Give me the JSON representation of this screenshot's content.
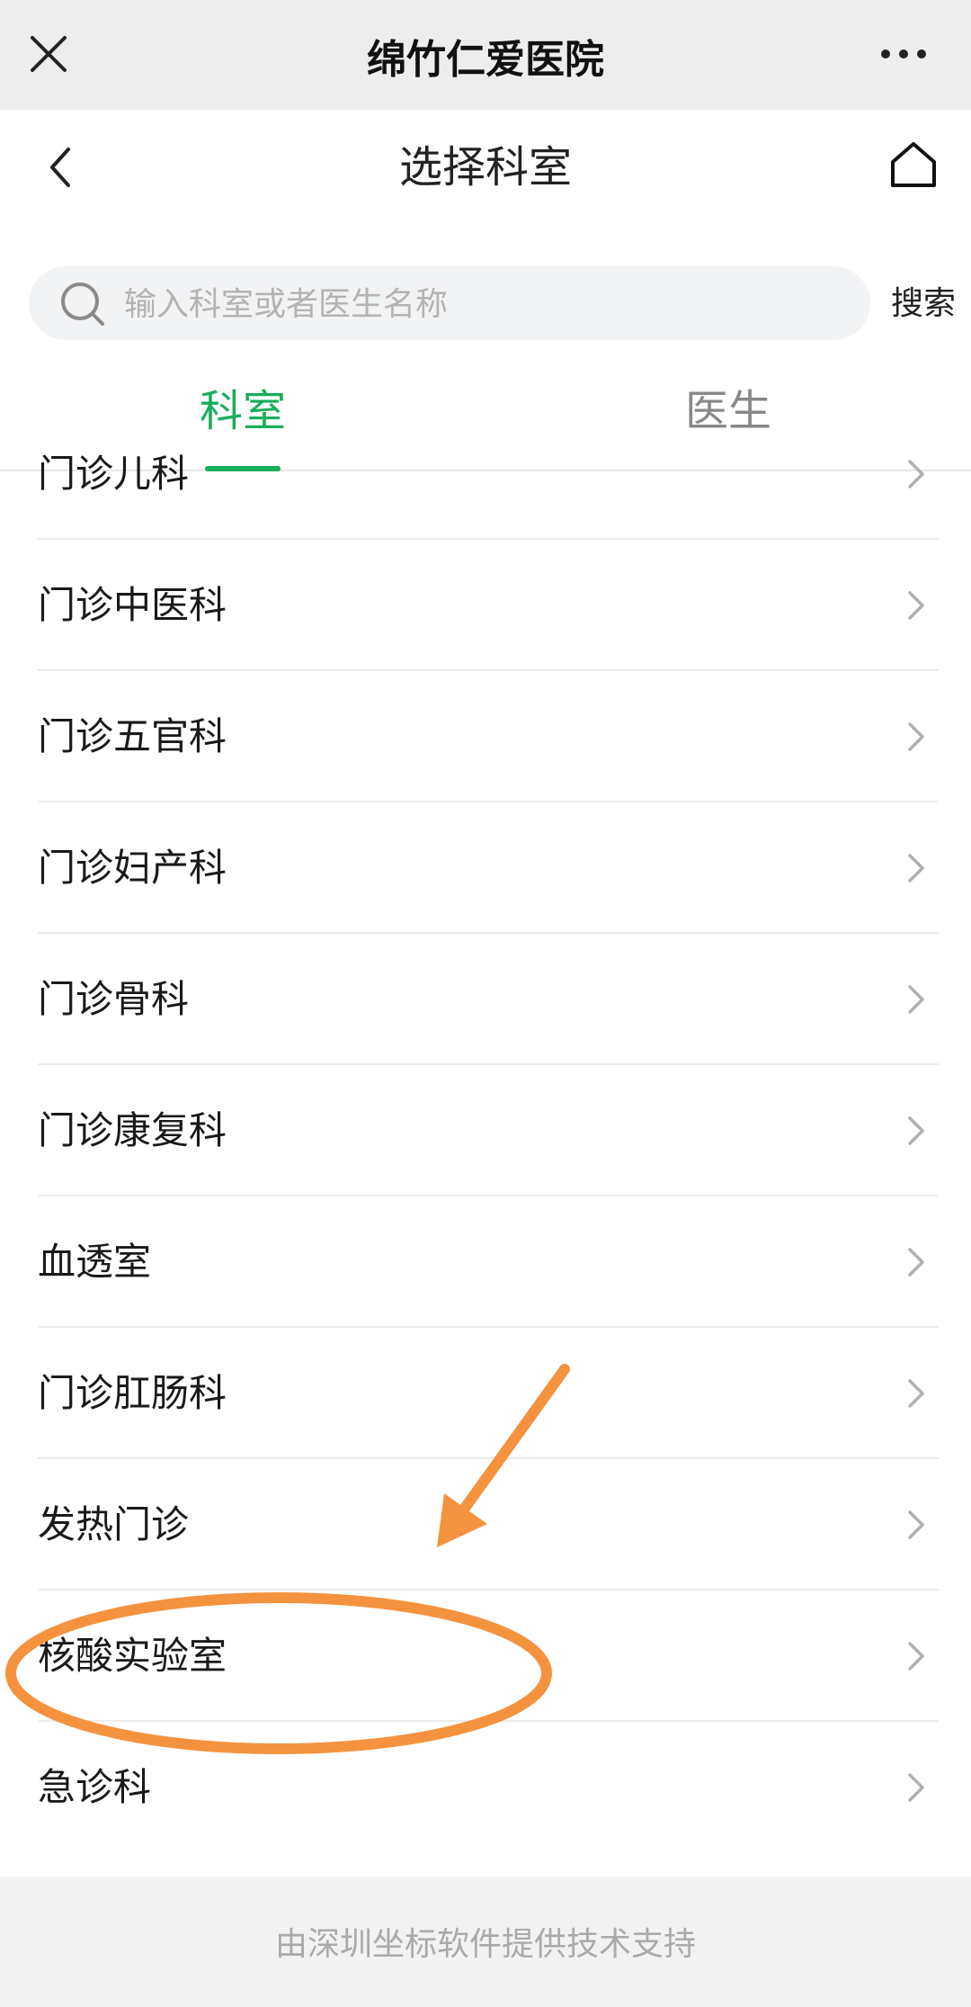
{
  "app_bar": {
    "title": "绵竹仁爱医院",
    "close_icon": "close-icon",
    "more_icon": "more-dots-icon"
  },
  "page_header": {
    "title": "选择科室",
    "back_icon": "chevron-left-icon",
    "home_icon": "home-icon"
  },
  "search": {
    "placeholder": "输入科室或者医生名称",
    "value": "",
    "button_label": "搜索",
    "icon": "search-icon"
  },
  "tabs": [
    {
      "label": "科室",
      "active": true
    },
    {
      "label": "医生",
      "active": false
    }
  ],
  "departments": [
    {
      "label": "门诊儿科"
    },
    {
      "label": "门诊中医科"
    },
    {
      "label": "门诊五官科"
    },
    {
      "label": "门诊妇产科"
    },
    {
      "label": "门诊骨科"
    },
    {
      "label": "门诊康复科"
    },
    {
      "label": "血透室"
    },
    {
      "label": "门诊肛肠科"
    },
    {
      "label": "发热门诊"
    },
    {
      "label": "核酸实验室"
    },
    {
      "label": "急诊科"
    }
  ],
  "footer": {
    "text": "由深圳坐标软件提供技术支持"
  },
  "colors": {
    "accent": "#1aad5c",
    "annotation": "#f5923e",
    "titlebar_bg": "#ededed",
    "footer_bg": "#f2f2f2"
  }
}
